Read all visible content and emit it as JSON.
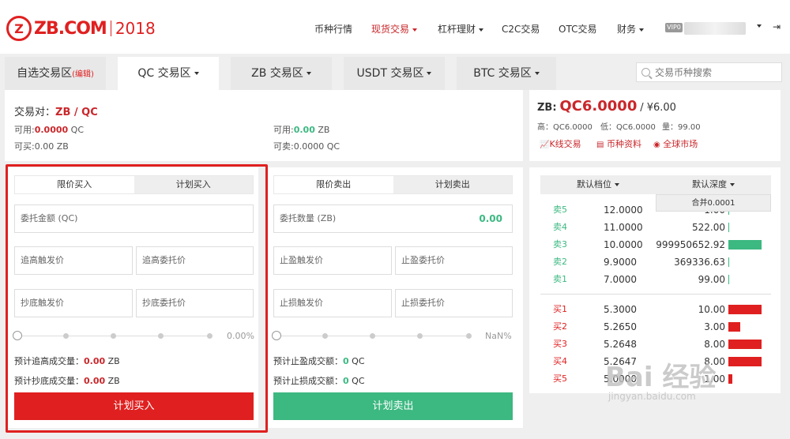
{
  "header": {
    "logo_mark": "Z",
    "logo_text": "ZB.COM",
    "logo_year": "2018",
    "nav": [
      {
        "label": "币种行情"
      },
      {
        "label": "现货交易"
      },
      {
        "label": "杠杆理财"
      },
      {
        "label": "C2C交易"
      },
      {
        "label": "OTC交易"
      },
      {
        "label": "财务"
      }
    ],
    "vip_badge": "VIP0",
    "logout_icon": "⇥"
  },
  "tabs": {
    "favorites_label": "自选交易区",
    "favorites_edit": "(编辑)",
    "qc": "QC 交易区",
    "zb": "ZB 交易区",
    "usdt": "USDT 交易区",
    "btc": "BTC 交易区"
  },
  "search": {
    "placeholder": "交易币种搜索"
  },
  "pair": {
    "label": "交易对：",
    "value": "ZB / QC",
    "avail_left_label": "可用:",
    "avail_left_value": "0.0000",
    "avail_left_unit": "QC",
    "buyable_label": "可买:",
    "buyable_value": "0.00 ZB",
    "avail_right_label": "可用:",
    "avail_right_value": "0.00",
    "avail_right_unit": "ZB",
    "sellable_label": "可卖:",
    "sellable_value": "0.0000 QC"
  },
  "quote": {
    "coin": "ZB:",
    "price": "QC6.0000",
    "cny": "/ ¥6.00",
    "high": "高：QC6.0000",
    "low": "低：QC6.0000",
    "volume": "量：99.00",
    "kline": "K线交易",
    "coininfo": "币种资料",
    "global": "全球市场"
  },
  "buy": {
    "tab_limit": "限价买入",
    "tab_plan": "计划买入",
    "amount_placeholder": "委托金额 (QC)",
    "chase_trigger": "追高触发价",
    "chase_order": "追高委托价",
    "dip_trigger": "抄底触发价",
    "dip_order": "抄底委托价",
    "percent": "0.00%",
    "slider_fraction": 0,
    "est_chase_label": "预计追高成交量：",
    "est_chase_value": "0.00",
    "est_chase_unit": "ZB",
    "est_dip_label": "预计抄底成交量：",
    "est_dip_value": "0.00",
    "est_dip_unit": "ZB",
    "button": "计划买入"
  },
  "sell": {
    "tab_limit": "限价卖出",
    "tab_plan": "计划卖出",
    "amount_placeholder": "委托数量 (ZB)",
    "amount_value": "0.00",
    "tp_trigger": "止盈触发价",
    "tp_order": "止盈委托价",
    "sl_trigger": "止损触发价",
    "sl_order": "止损委托价",
    "percent": "NaN%",
    "slider_fraction": 0,
    "est_tp_label": "预计止盈成交额：",
    "est_tp_value": "0",
    "est_tp_unit": "QC",
    "est_sl_label": "预计止损成交额：",
    "est_sl_value": "0",
    "est_sl_unit": "QC",
    "button": "计划卖出"
  },
  "book": {
    "head_level": "默认档位",
    "head_depth": "默认深度",
    "merge": "合并0.0001",
    "asks": [
      {
        "label": "卖5",
        "price": "12.0000",
        "amount": "1.00",
        "fraction": 0
      },
      {
        "label": "卖4",
        "price": "11.0000",
        "amount": "522.00",
        "fraction": 0
      },
      {
        "label": "卖3",
        "price": "10.0000",
        "amount": "999950652.92",
        "fraction": 1
      },
      {
        "label": "卖2",
        "price": "9.9000",
        "amount": "369336.63",
        "fraction": 0
      },
      {
        "label": "卖1",
        "price": "7.0000",
        "amount": "99.00",
        "fraction": 0
      }
    ],
    "bids": [
      {
        "label": "买1",
        "price": "5.3000",
        "amount": "10.00",
        "fraction": 1
      },
      {
        "label": "买2",
        "price": "5.2650",
        "amount": "3.00",
        "fraction": 0.35
      },
      {
        "label": "买3",
        "price": "5.2648",
        "amount": "8.00",
        "fraction": 1
      },
      {
        "label": "买4",
        "price": "5.2647",
        "amount": "8.00",
        "fraction": 1
      },
      {
        "label": "买5",
        "price": "5.0000",
        "amount": "1.00",
        "fraction": 0.12
      }
    ],
    "ask_color": "#3cb881",
    "bid_color": "#e02020"
  },
  "watermark": {
    "main": "Bai 经验",
    "sub": "jingyan.baidu.com"
  },
  "colors": {
    "brand_red": "#e02020",
    "buy_red": "#e02020",
    "sell_green": "#3cb881"
  }
}
